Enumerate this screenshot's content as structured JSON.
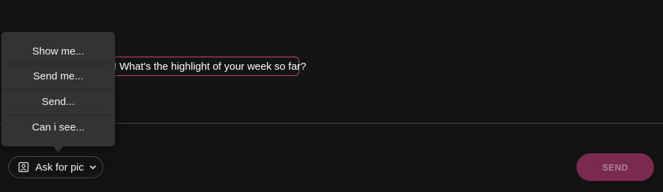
{
  "chat": {
    "message_text": "! What's the highlight of your week so far?"
  },
  "menu": {
    "items": [
      {
        "label": "Show me..."
      },
      {
        "label": "Send me..."
      },
      {
        "label": "Send..."
      },
      {
        "label": "Can i see..."
      }
    ]
  },
  "composer": {
    "ask_pic_label": "Ask for pic",
    "send_label": "SEND",
    "icons": {
      "ask_pic": "selfie-photo-icon",
      "dropdown": "chevron-down-icon"
    }
  },
  "colors": {
    "accent": "#d2477a",
    "send_button_bg": "#7b2a4f",
    "menu_bg": "#333333"
  }
}
